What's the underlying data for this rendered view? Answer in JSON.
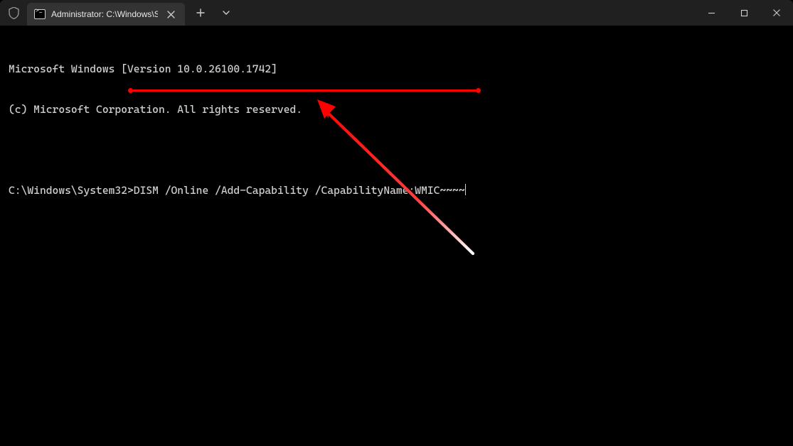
{
  "window": {
    "tab_title": "Administrator: C:\\Windows\\Sy",
    "tab_icon": "cmd-icon",
    "leading_icon": "shield-icon"
  },
  "terminal": {
    "banner_line1": "Microsoft Windows [Version 10.0.26100.1742]",
    "banner_line2": "(c) Microsoft Corporation. All rights reserved.",
    "prompt": "C:\\Windows\\System32>",
    "command": "DISM /Online /Add-Capability /CapabilityName:WMIC~~~~"
  },
  "annotation": {
    "underline_color": "#ff0000",
    "arrow_color_start": "#ff0000",
    "arrow_color_end": "#ffffff"
  }
}
